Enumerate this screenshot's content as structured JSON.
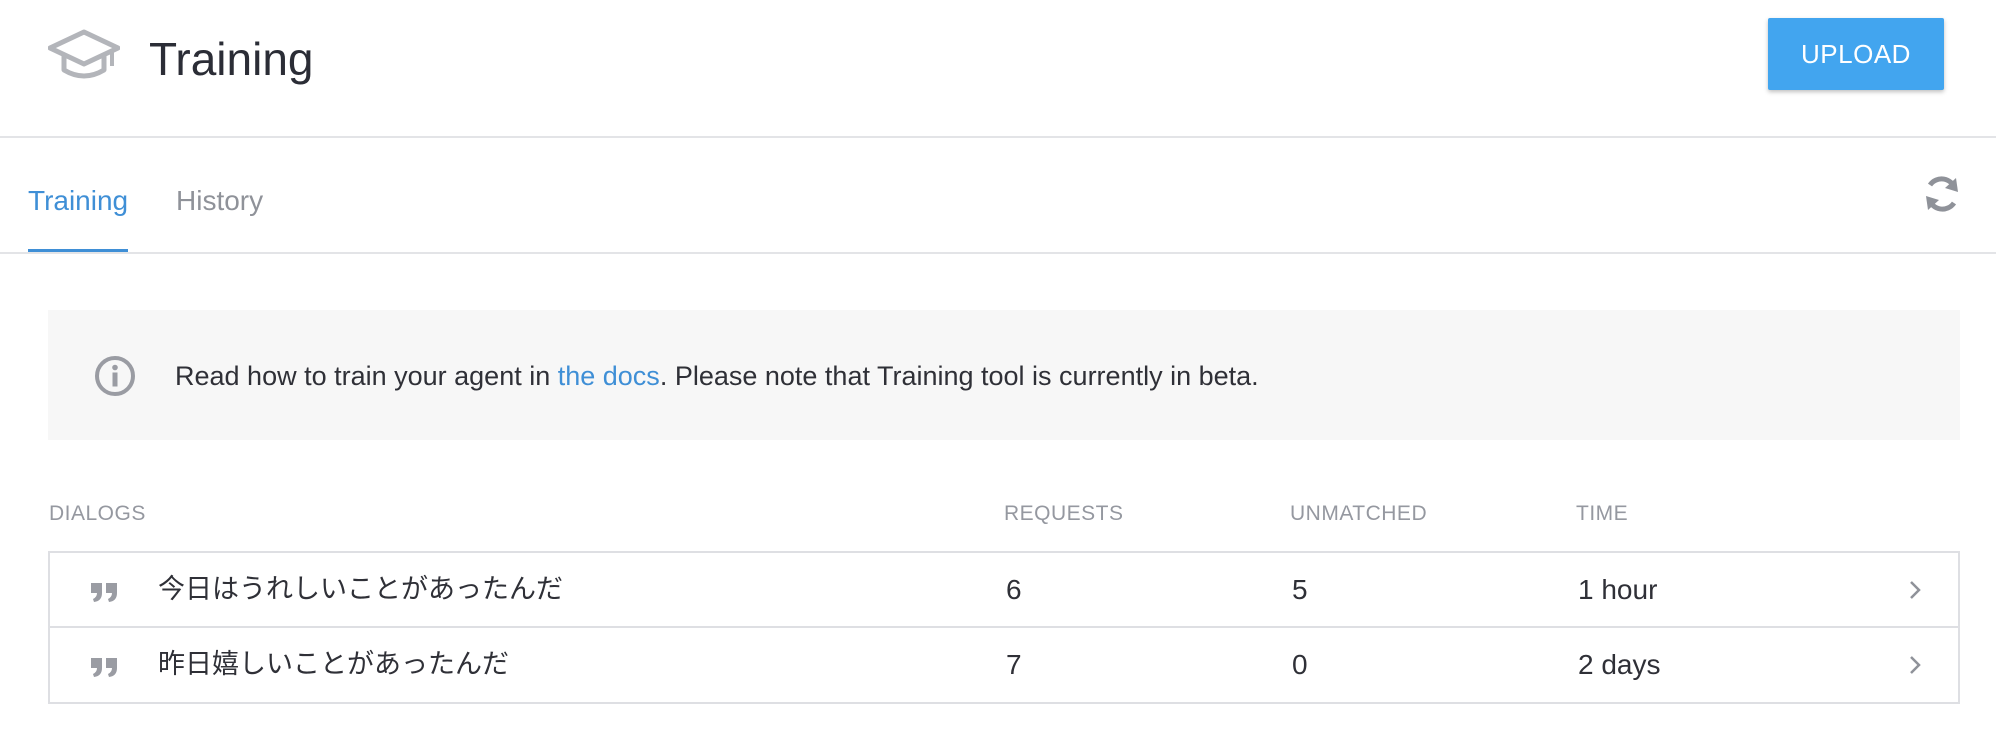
{
  "header": {
    "title": "Training",
    "logo_icon": "graduation-cap-icon",
    "upload_label": "UPLOAD"
  },
  "tabs": [
    {
      "label": "Training",
      "active": true
    },
    {
      "label": "History",
      "active": false
    }
  ],
  "info": {
    "text_before": "Read how to train your agent in ",
    "link_text": "the docs",
    "text_after": ". Please note that Training tool is currently in beta."
  },
  "table": {
    "columns": [
      "DIALOGS",
      "REQUESTS",
      "UNMATCHED",
      "TIME"
    ],
    "rows": [
      {
        "dialog": "今日はうれしいことがあったんだ",
        "requests": "6",
        "unmatched": "5",
        "time": "1 hour"
      },
      {
        "dialog": "昨日嬉しいことがあったんだ",
        "requests": "7",
        "unmatched": "0",
        "time": "2 days"
      }
    ]
  },
  "colors": {
    "accent": "#3f8fd6",
    "button": "#42a5ef",
    "icon_gray": "#9a9ca3"
  }
}
